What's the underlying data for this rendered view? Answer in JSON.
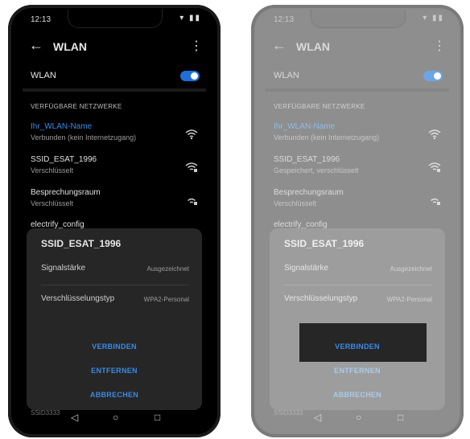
{
  "status": {
    "time": "12:13",
    "icons": "▾ ▮▮"
  },
  "header": {
    "title": "WLAN",
    "back_icon": "←",
    "more_icon": "⋮"
  },
  "wlan": {
    "label": "WLAN",
    "enabled": true
  },
  "section_title": "VERFÜGBARE NETZWERKE",
  "networks_left": [
    {
      "name": "Ihr_WLAN-Name",
      "status": "Verbunden (kein Internetzugang)"
    },
    {
      "name": "SSID_ESAT_1996",
      "status": "Verschlüsselt"
    },
    {
      "name": "Besprechungsraum",
      "status": "Verschlüsselt"
    },
    {
      "name": "electrify_config",
      "status": ""
    }
  ],
  "networks_right": [
    {
      "name": "Ihr_WLAN-Name",
      "status": "Verbunden (kein Internetzugang)"
    },
    {
      "name": "SSID_ESAT_1996",
      "status": "Gespeichert, verschlüsselt"
    },
    {
      "name": "Besprechungsraum",
      "status": "Verschlüsselt"
    },
    {
      "name": "electrify_config",
      "status": ""
    }
  ],
  "dialog": {
    "title": "SSID_ESAT_1996",
    "signal_label": "Signalstärke",
    "signal_value": "Ausgezeichnet",
    "security_label": "Verschlüsselungstyp",
    "security_value": "WPA2-Personal",
    "connect": "VERBINDEN",
    "remove": "ENTFERNEN",
    "cancel": "ABBRECHEN"
  },
  "peek": "SSID3333",
  "nav": {
    "back": "◁",
    "home": "○",
    "recents": "□"
  },
  "colors": {
    "accent": "#3b8ae6",
    "toggle": "#1f6fd6"
  }
}
